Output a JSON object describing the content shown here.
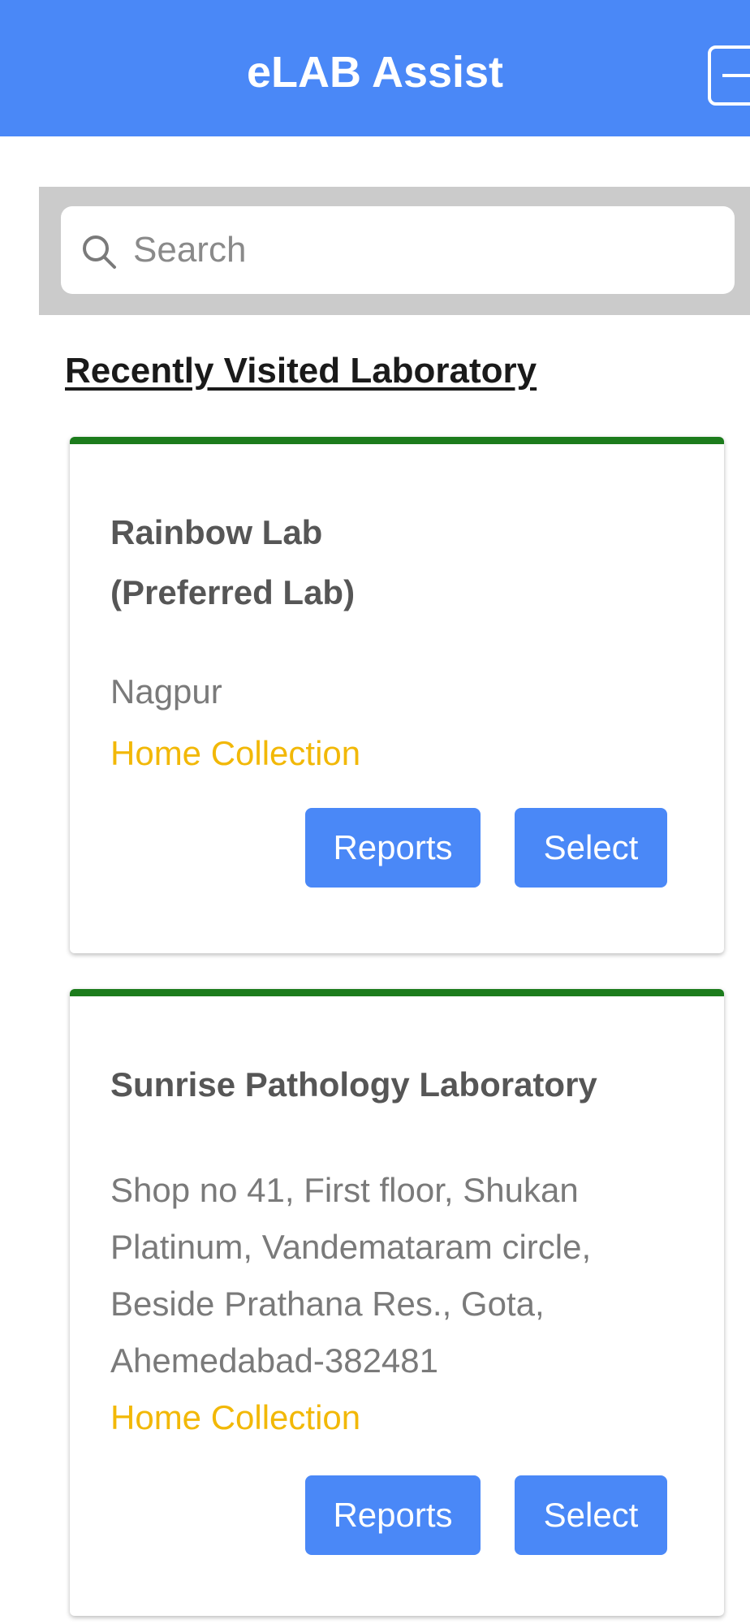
{
  "header": {
    "title": "eLAB Assist",
    "logout_icon": "logout-icon",
    "background_color": "#4a88f7"
  },
  "search": {
    "placeholder": "Search",
    "value": "",
    "icon": "search-icon"
  },
  "section": {
    "title": "Recently Visited Laboratory"
  },
  "labs": [
    {
      "name": "Rainbow Lab",
      "subtitle": "(Preferred Lab)",
      "address": "Nagpur",
      "service": "Home Collection",
      "reports_label": "Reports",
      "select_label": "Select"
    },
    {
      "name": "Sunrise Pathology Laboratory",
      "address_lines": [
        "Shop no 41, First floor, Shukan",
        "Platinum, Vandemataram circle,",
        "Beside Prathana Res., Gota,",
        "Ahemedabad-382481"
      ],
      "service": "Home Collection",
      "reports_label": "Reports",
      "select_label": "Select"
    }
  ],
  "colors": {
    "accent": "#4a88f7",
    "card_border": "#1c7c1c",
    "service_text": "#f2b807"
  }
}
